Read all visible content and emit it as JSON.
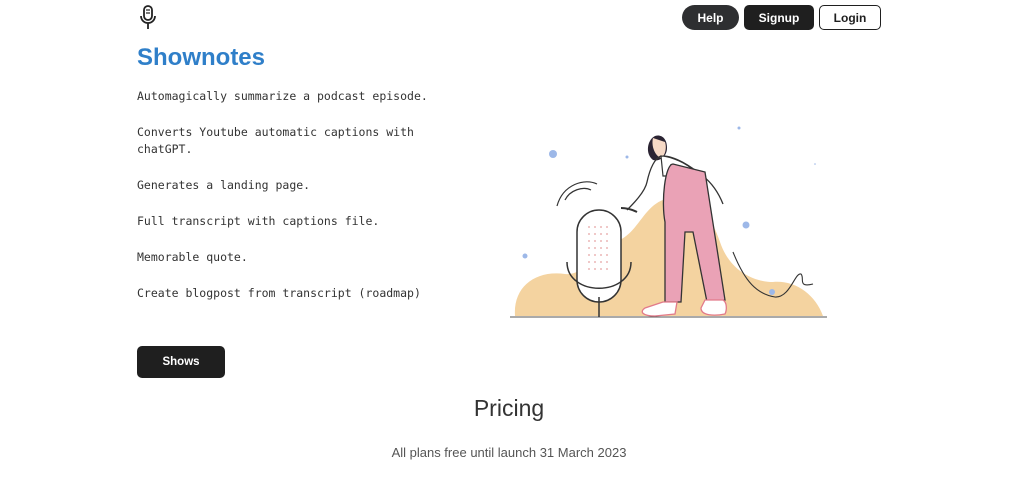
{
  "header": {
    "logo_icon": "microphone-icon",
    "help_label": "Help",
    "signup_label": "Signup",
    "login_label": "Login"
  },
  "hero": {
    "title": "Shownotes",
    "features": [
      "Automagically summarize a podcast episode.",
      "Converts Youtube automatic captions with chatGPT.",
      "Generates a landing page.",
      "Full transcript with captions file.",
      "Memorable quote.",
      "Create blogpost from transcript (roadmap)"
    ],
    "shows_label": "Shows",
    "illustration": "woman-with-microphone-illustration"
  },
  "pricing": {
    "title": "Pricing",
    "subtitle": "All plans free until launch 31 March 2023"
  },
  "colors": {
    "title_blue": "#2f7fc9",
    "dark_button": "#1f1f1f",
    "blob_yellow": "#f4d3a0",
    "pants_pink": "#eaa2b6",
    "dot_blue": "#9db8e8"
  }
}
